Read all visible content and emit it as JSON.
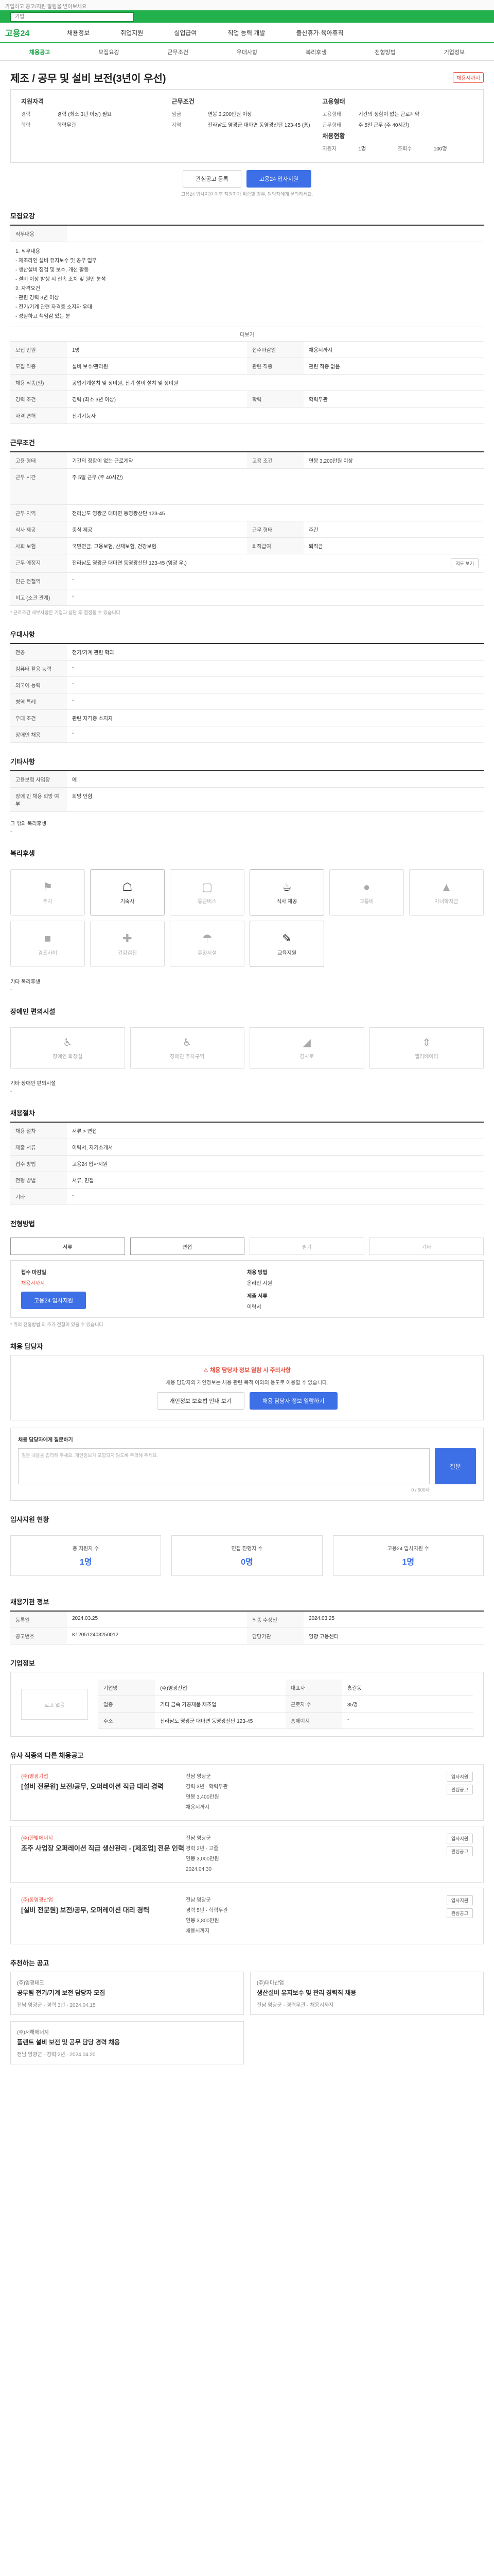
{
  "top_strip": "가입하고 공고/지원 알림을 받아보세요",
  "search": {
    "placeholder": "기업"
  },
  "gnb": {
    "logo": "고용24",
    "items": [
      "채용정보",
      "취업지원",
      "실업급여",
      "직업 능력 개발",
      "출산휴가·육아휴직"
    ]
  },
  "tabs": [
    "채용공고",
    "모집요강",
    "근무조건",
    "우대사항",
    "복리후생",
    "전형방법",
    "기업정보"
  ],
  "title": "제조 / 공무 및 설비 보전(3년이 우선)",
  "badge": "채용시까지",
  "summary": {
    "left_title": "지원자격",
    "left": [
      [
        "경력",
        "경력 (최소 3년 이상) 필요"
      ],
      [
        "학력",
        "학력무관"
      ]
    ],
    "mid_title": "근무조건",
    "mid": [
      [
        "임금",
        "연봉 3,200만원 이상"
      ],
      [
        "지역",
        "전라남도 영광군 대마면 동영광산단 123-45 (홍)"
      ]
    ],
    "right_title": "고용형태",
    "right": [
      [
        "고용형태",
        "기간의 정함이 없는 근로계약"
      ],
      [
        "근무형태",
        "주 5일 근무 (주 40시간)"
      ]
    ],
    "right2_title": "채용현황",
    "right2": [
      [
        "지원자",
        "1명",
        "조회수",
        "100명"
      ]
    ]
  },
  "buttons": {
    "scrap": "관심공고 등록",
    "apply": "고용24 입사지원"
  },
  "apply_note": "고용24 입사지원 이후 지원자가 위중할 경우, 담당자에게 문의하세요.",
  "recruit": {
    "heading": "모집요강",
    "duties_title": "직무내용",
    "duties": [
      "1. 직무내용",
      "- 제조라인 설비 유지보수 및 공무 업무",
      "- 생산설비 점검 및 보수, 개선 활동",
      "- 설비 이상 발생 시 신속 조치 및 원인 분석",
      "2. 자격요건",
      "- 관련 경력 3년 이상",
      "- 전기/기계 관련 자격증 소지자 우대",
      "- 성실하고 책임감 있는 분"
    ],
    "more": "더보기",
    "rows": [
      [
        "모집 인원",
        "1명",
        "접수마감일",
        "채용시까지"
      ],
      [
        "모집 직종",
        "설비 보수/관리원",
        "관련 직종",
        "관련 직종 없음"
      ],
      [
        "채용 직종(일)",
        "공업기계설치 및 정비원, 전기 설비 설치 및 정비원"
      ],
      [
        "경력 조건",
        "경력 (최소 3년 이상)",
        "학력",
        "학력무관"
      ],
      [
        "자격 면허",
        "전기기능사"
      ]
    ]
  },
  "conditions": {
    "heading": "근무조건",
    "rows": [
      [
        "고용 형태",
        "기간의 정함이 없는 근로계약",
        "고용 조건",
        "연봉 3,200만원 이상"
      ],
      [
        "근무 시간",
        "주 5일 근무 (주 40시간)"
      ],
      [
        "근무 지역",
        "전라남도 영광군 대마면 동영광산단 123-45"
      ],
      [
        "식사 제공",
        "중식 제공",
        "근무 형태",
        "주간"
      ],
      [
        "사회 보험",
        "국민연금, 고용보험, 산재보험, 건강보험",
        "퇴직급여",
        "퇴직금"
      ],
      [
        "근무 예정지",
        "전라남도 영광군 대마면 동영광산단 123-45 (영광 우.)"
      ],
      [
        "인근 전철역",
        "-"
      ],
      [
        "비고 (소관 관계)",
        "-"
      ]
    ],
    "map_btn": "지도 보기",
    "footnote": "* 근로조건 세부사항은 기업과 상담 후 결정될 수 있습니다."
  },
  "preference": {
    "heading": "우대사항",
    "rows": [
      [
        "전공",
        "전기/기계 관련 학과"
      ],
      [
        "컴퓨터 활용 능력",
        "-"
      ],
      [
        "외국어 능력",
        "-"
      ],
      [
        "병역 특례",
        "-"
      ],
      [
        "우대 조건",
        "관련 자격증 소지자"
      ],
      [
        "장애인 채용",
        "-"
      ]
    ]
  },
  "other": {
    "heading": "기타사항",
    "rows": [
      [
        "고용보험 사업장",
        "예"
      ],
      [
        "장애 인 채용 희망 여부",
        "희망 안함"
      ]
    ],
    "extra_title": "그 밖의 복리후생",
    "extra": "-"
  },
  "welfare": {
    "heading": "복리후생",
    "items": [
      [
        "주차",
        false
      ],
      [
        "기숙사",
        true
      ],
      [
        "통근버스",
        false
      ],
      [
        "식사 제공",
        true
      ],
      [
        "교통비",
        false
      ],
      [
        "자녀학자금",
        false
      ],
      [
        "경조사비",
        false
      ],
      [
        "건강검진",
        false
      ],
      [
        "휴양시설",
        false
      ],
      [
        "교육지원",
        true
      ]
    ],
    "extra_title": "기타 복리후생",
    "extra": "-"
  },
  "barrier_free": {
    "heading": "장애인 편의시설",
    "items": [
      "장애인 화장실",
      "장애인 주차구역",
      "경사로",
      "엘리베이터"
    ],
    "extra_title": "기타 장애인 편의시설",
    "extra": "-"
  },
  "process": {
    "heading": "채용절차",
    "rows": [
      [
        "채용 절차",
        "서류 > 면접"
      ],
      [
        "제출 서류",
        "이력서, 자기소개서"
      ],
      [
        "접수 방법",
        "고용24 입사지원"
      ],
      [
        "전형 방법",
        "서류, 면접"
      ],
      [
        "기타",
        "-"
      ]
    ]
  },
  "method": {
    "heading": "전형방법",
    "items": [
      [
        "서류",
        true
      ],
      [
        "면접",
        true
      ],
      [
        "필기",
        false
      ],
      [
        "기타",
        false
      ]
    ],
    "apply_title": "접수 마감일",
    "apply_date": "채용시까지",
    "apply_btn": "고용24 입사지원",
    "right_title": "채용 방법",
    "right_value": "온라인 지원",
    "right_title2": "제출 서류",
    "right_value2": "이력서",
    "note": "* 위의 전형방법 외 추가 전형이 있을 수 있습니다."
  },
  "manager": {
    "heading": "채용 담당자",
    "warn": "채용 담당자 정보 열람 시 주의사항",
    "desc": "채용 담당자의 개인정보는 채용 관련 목적 이외의 용도로 이용할 수 없습니다.",
    "btn1": "개인정보 보호법 안내 보기",
    "btn2": "채용 담당자 정보 열람하기",
    "inquiry_title": "채용 담당자에게 질문하기",
    "inquiry_placeholder": "질문 내용을 입력해 주세요. 개인정보가 포함되지 않도록 주의해 주세요.",
    "inquiry_count": "0 / 500자",
    "inquiry_btn": "질문"
  },
  "status": {
    "heading": "입사지원 현황",
    "items": [
      [
        "총 지원자 수",
        "1명"
      ],
      [
        "면접 진행자 수",
        "0명"
      ],
      [
        "고용24 입사지원 수",
        "1명"
      ]
    ]
  },
  "info": {
    "heading": "채용기관 정보",
    "rows": [
      [
        "등록일",
        "2024.03.25",
        "최종 수정일",
        "2024.03.25"
      ],
      [
        "공고번호",
        "K120512403250012",
        "담당기관",
        "영광 고용센터"
      ]
    ]
  },
  "company": {
    "heading": "기업정보",
    "logo": "로고 없음",
    "rows": [
      [
        "기업명",
        "(주)영광산업",
        "대표자",
        "홍길동"
      ],
      [
        "업종",
        "기타 금속 가공제품 제조업",
        "근로자 수",
        "35명"
      ],
      [
        "주소",
        "전라남도 영광군 대마면 동영광산단 123-45",
        "홈페이지",
        "-"
      ]
    ]
  },
  "similar": {
    "heading": "유사 직종의 다른 채용공고",
    "jobs": [
      {
        "co": "(주)영광기업",
        "title": "[설비 전문원] 보전/공무, 오퍼레이션 직급 대리 경력",
        "region": "전남 영광군",
        "career": "경력 3년",
        "edu": "학력무관",
        "pay": "연봉 3,400만원",
        "deadline": "채용시까지"
      },
      {
        "co": "(주)한빛에너지",
        "title": "조주 사업장 오퍼레이션 직급 생산관리 - [제조업] 전문 인력",
        "region": "전남 영광군",
        "career": "경력 2년",
        "edu": "고졸",
        "pay": "연봉 3,000만원",
        "deadline": "2024.04.30"
      },
      {
        "co": "(주)동영광산업",
        "title": "[설비 전문원] 보전/공무, 오퍼레이션 대리 경력",
        "region": "전남 영광군",
        "career": "경력 5년",
        "edu": "학력무관",
        "pay": "연봉 3,800만원",
        "deadline": "채용시까지"
      }
    ],
    "apply_btn": "입사지원",
    "scrap_btn": "관심공고"
  },
  "recommend": {
    "heading": "추천하는 공고",
    "items": [
      {
        "co": "(주)영광테크",
        "title": "공무팀 전기/기계 보전 담당자 모집",
        "meta": "전남 영광군 · 경력 3년 · 2024.04.15"
      },
      {
        "co": "(주)대마산업",
        "title": "생산설비 유지보수 및 관리 경력직 채용",
        "meta": "전남 영광군 · 경력무관 · 채용시까지"
      },
      {
        "co": "(주)서해에너지",
        "title": "플랜트 설비 보전 및 공무 담당 경력 채용",
        "meta": "전남 영광군 · 경력 2년 · 2024.04.20"
      }
    ]
  }
}
